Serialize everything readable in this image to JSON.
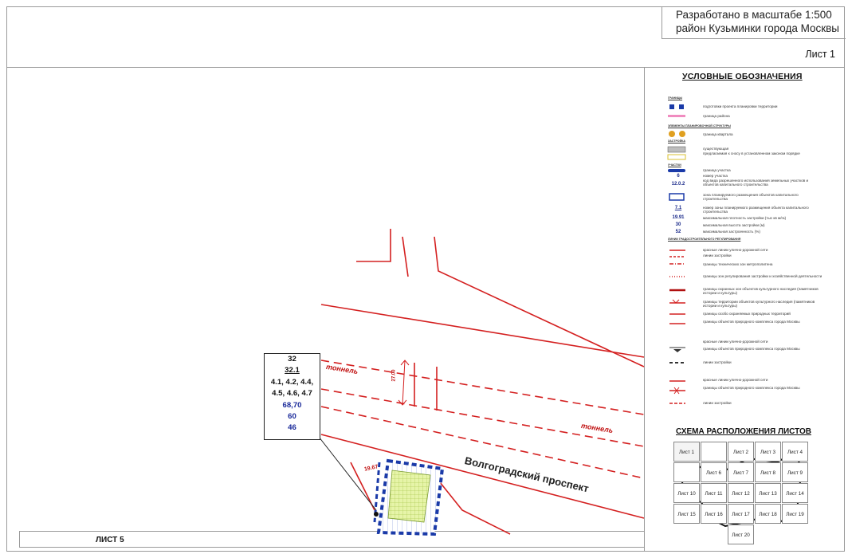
{
  "header": {
    "line1": "Разработано в масштабе 1:500",
    "line2": "район Кузьминки города Москвы",
    "sheet": "Лист 1"
  },
  "legend": {
    "title": "УСЛОВНЫЕ ОБОЗНАЧЕНИЯ",
    "groups": [
      "ГРАНИЦЫ",
      "ЭЛЕМЕНТЫ ПЛАНИРОВОЧНОЙ СТРУКТУРЫ",
      "ЗАСТРОЙКА",
      "УЧАСТКИ",
      "ЛИНИИ ГРАДОСТРОИТЕЛЬНОГО РЕГУЛИРОВАНИЯ"
    ],
    "items": [
      "подготовки проекта планировки территории",
      "граница района",
      "граница квартала",
      "существующая",
      "предлагаемая к сносу в установленном законом порядке",
      "граница участка",
      "номер участка",
      "код вида разрешенного использования земельных участков и объектов капитального строительства",
      "зона планируемого размещения объектов капитального строительства",
      "номер зоны планируемого размещения объекта капитального строительства",
      "максимальная плотность застройки (тыс кв м/га)",
      "максимальная высота застройки (м)",
      "максимальная застроенность (%)",
      "красные линии улично-дорожной сети",
      "линии застройки",
      "границы технических зон метрополитена",
      "границы зон регулирования застройки и хозяйственной деятельности",
      "границы охранных зон объектов культурного наследия (памятников истории и культуры)",
      "границы территории объектов культурного наследия (памятников истории и культуры)",
      "границы особо охраняемых природных территорий",
      "границы объектов природного комплекса города Москвы",
      "красные линии улично-дорожной сети",
      "границы объектов природного комплекса города Москвы",
      "линии застройки",
      "красные линии улично-дорожной сети",
      "границы объектов природного комплекса города Москвы",
      "линии застройки"
    ],
    "sample_numbers": {
      "parcel": "6",
      "code": "12.0.2",
      "zone": "7.1",
      "density": "19.91",
      "height": "30",
      "coverage": "52"
    }
  },
  "schema": {
    "title": "СХЕМА РАСПОЛОЖЕНИЯ ЛИСТОВ",
    "cells": [
      "Лист 1",
      "",
      "Лист 2",
      "Лист 3",
      "Лист 4",
      "",
      "Лист 6",
      "Лист 7",
      "Лист 8",
      "Лист 9",
      "Лист 10",
      "Лист 11",
      "Лист 12",
      "Лист 13",
      "Лист 14",
      "Лист 15",
      "Лист 16",
      "Лист 17",
      "Лист 18",
      "Лист 19",
      "",
      "",
      "Лист 20",
      "",
      ""
    ],
    "highlighted": "Лист 1",
    "current": "Лист 5"
  },
  "map": {
    "street": "Волгоградский проспект",
    "tunnel_label": "тоннель",
    "dimension_label": "27.00",
    "small_dim": "19.67",
    "info_box": [
      "32",
      "32.1",
      "4.1, 4.2, 4.4,",
      "4.5, 4.6, 4.7",
      "68,70",
      "60",
      "46"
    ]
  },
  "footer": {
    "sheet_label": "ЛИСТ 5"
  },
  "colors": {
    "red_line": "#d42020",
    "parcel_border": "#1a3aa8",
    "zone_fill": "#dff0a0",
    "text_blue": "#1a2a9a"
  }
}
